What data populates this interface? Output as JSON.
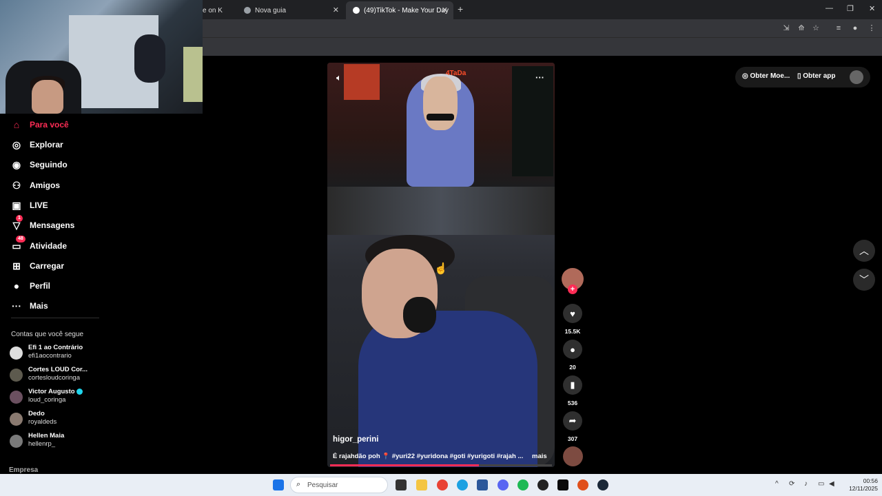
{
  "browser": {
    "tabs": [
      {
        "label": "e on K",
        "active": false
      },
      {
        "label": "Nova guia",
        "active": false
      },
      {
        "label": "(49)TikTok - Make Your Day",
        "active": true
      }
    ],
    "new_tab_symbol": "+",
    "close_symbol": "✕",
    "window_controls": [
      "—",
      "❐",
      "✕"
    ]
  },
  "sidebar": {
    "nav": [
      {
        "label": "Para você",
        "icon": "home-icon",
        "glyph": "⌂",
        "active": true
      },
      {
        "label": "Explorar",
        "icon": "compass-icon",
        "glyph": "◎"
      },
      {
        "label": "Seguindo",
        "icon": "following-icon",
        "glyph": "◉"
      },
      {
        "label": "Amigos",
        "icon": "friends-icon",
        "glyph": "⚇"
      },
      {
        "label": "LIVE",
        "icon": "live-icon",
        "glyph": "▣"
      },
      {
        "label": "Mensagens",
        "icon": "messages-icon",
        "glyph": "▽",
        "badge": "1"
      },
      {
        "label": "Atividade",
        "icon": "activity-icon",
        "glyph": "▭",
        "badge": "48"
      },
      {
        "label": "Carregar",
        "icon": "upload-icon",
        "glyph": "⊞"
      },
      {
        "label": "Perfil",
        "icon": "profile-icon",
        "glyph": "●"
      },
      {
        "label": "Mais",
        "icon": "more-icon",
        "glyph": "···"
      }
    ],
    "following_title": "Contas que você segue",
    "accounts": [
      {
        "name": "Efi 1 ao Contrário",
        "handle": "efi1aocontrario",
        "verified": false
      },
      {
        "name": "Cortes LOUD Cor...",
        "handle": "cortesloudcoringa",
        "verified": false
      },
      {
        "name": "Victor Augusto",
        "handle": "loud_coringa",
        "verified": true
      },
      {
        "name": "Dedo",
        "handle": "royaldeds",
        "verified": false
      },
      {
        "name": "Hellen Maia",
        "handle": "hellenrp_",
        "verified": false
      }
    ],
    "footer": "Empresa"
  },
  "header_actions": {
    "coins_label": "Obter Moe...",
    "app_label": "Obter app"
  },
  "video": {
    "author": "higor_perini",
    "caption": "É rajahdão poh 📍 #yuri22 #yuridona #goti #yurigoti #rajah ...",
    "more_label": "mais",
    "brand_overlay": "4TaDa",
    "progress": 0.67,
    "more_dots": "···"
  },
  "actions": {
    "likes": "15.5K",
    "comments": "20",
    "saves": "536",
    "shares": "307"
  },
  "taskbar": {
    "search_placeholder": "Pesquisar",
    "time": "00:56",
    "date": "12/11/2025"
  }
}
